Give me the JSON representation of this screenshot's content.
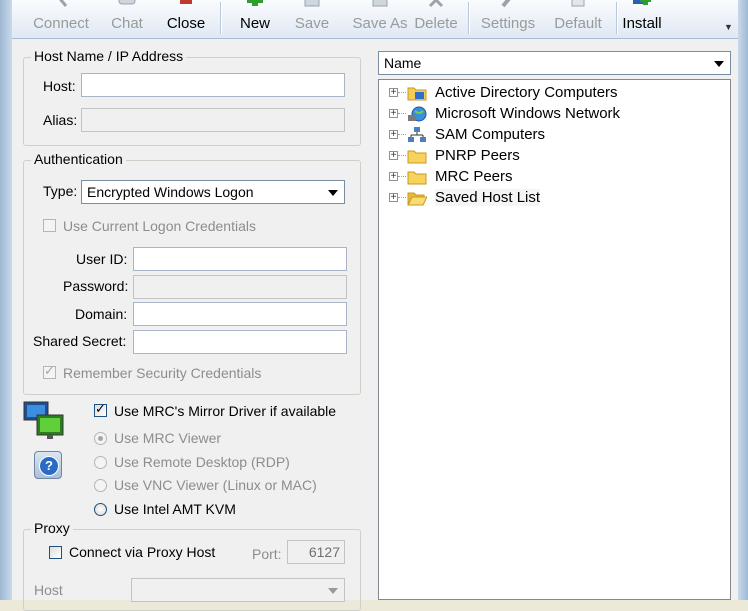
{
  "toolbar": {
    "buttons": [
      {
        "label": "Connect",
        "enabled": false,
        "icon": "connect-icon"
      },
      {
        "label": "Chat",
        "enabled": false,
        "icon": "chat-icon"
      },
      {
        "label": "Close",
        "enabled": true,
        "icon": "close-icon"
      },
      {
        "label": "New",
        "enabled": true,
        "icon": "new-icon"
      },
      {
        "label": "Save",
        "enabled": false,
        "icon": "save-icon"
      },
      {
        "label": "Save As",
        "enabled": false,
        "icon": "save-as-icon"
      },
      {
        "label": "Delete",
        "enabled": false,
        "icon": "delete-icon"
      },
      {
        "label": "Settings",
        "enabled": false,
        "icon": "settings-icon"
      },
      {
        "label": "Default",
        "enabled": false,
        "icon": "default-icon"
      },
      {
        "label": "Install",
        "enabled": true,
        "icon": "install-icon"
      }
    ]
  },
  "host_group": {
    "title": "Host Name / IP Address",
    "host_label": "Host:",
    "host_value": "",
    "alias_label": "Alias:",
    "alias_value": ""
  },
  "auth_group": {
    "title": "Authentication",
    "type_label": "Type:",
    "type_value": "Encrypted Windows Logon",
    "use_current_label": "Use Current Logon Credentials",
    "userid_label": "User ID:",
    "password_label": "Password:",
    "domain_label": "Domain:",
    "secret_label": "Shared Secret:",
    "remember_label": "Remember Security Credentials"
  },
  "viewer": {
    "mirror_label": "Use MRC's Mirror Driver if available",
    "mrc_viewer_label": "Use MRC Viewer",
    "rdp_label": "Use Remote Desktop (RDP)",
    "vnc_label": "Use VNC Viewer (Linux or MAC)",
    "amt_label": "Use Intel AMT KVM"
  },
  "proxy_group": {
    "title": "Proxy",
    "connect_label": "Connect via Proxy Host",
    "port_label": "Port:",
    "port_value": "6127",
    "host_label": "Host"
  },
  "tree": {
    "column_label": "Name",
    "nodes": [
      {
        "label": "Active Directory Computers",
        "icon": "active-directory-icon"
      },
      {
        "label": "Microsoft Windows Network",
        "icon": "network-globe-icon"
      },
      {
        "label": "SAM Computers",
        "icon": "sam-computers-icon"
      },
      {
        "label": "PNRP Peers",
        "icon": "folder-icon"
      },
      {
        "label": "MRC Peers",
        "icon": "folder-icon"
      },
      {
        "label": "Saved Host List",
        "icon": "open-folder-icon"
      }
    ]
  }
}
